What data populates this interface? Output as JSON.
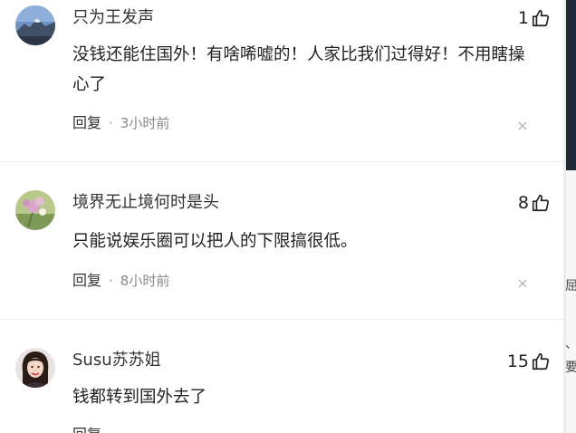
{
  "comments": [
    {
      "username": "只为王发声",
      "likes": "1",
      "text": "没钱还能住国外！有啥唏嘘的！人家比我们过得好！不用瞎操心了",
      "reply_label": "回复",
      "separator": "·",
      "time": "3小时前",
      "avatar_icon": "mountain-landscape-avatar"
    },
    {
      "username": "境界无止境何时是头",
      "likes": "8",
      "text": "只能说娱乐圈可以把人的下限搞很低。",
      "reply_label": "回复",
      "separator": "·",
      "time": "8小时前",
      "avatar_icon": "flower-avatar"
    },
    {
      "username": "Susu苏苏姐",
      "likes": "15",
      "text": "钱都转到国外去了",
      "reply_label": "回复",
      "separator": "·",
      "time": "",
      "avatar_icon": "woman-portrait-avatar"
    }
  ],
  "right_edge": {
    "fragments": [
      "屈",
      "、",
      "要"
    ]
  },
  "colors": {
    "text": "#222222",
    "meta": "#888888",
    "background": "#ffffff"
  },
  "icons": {
    "like": "thumbs-up-icon",
    "close": "close-icon"
  }
}
